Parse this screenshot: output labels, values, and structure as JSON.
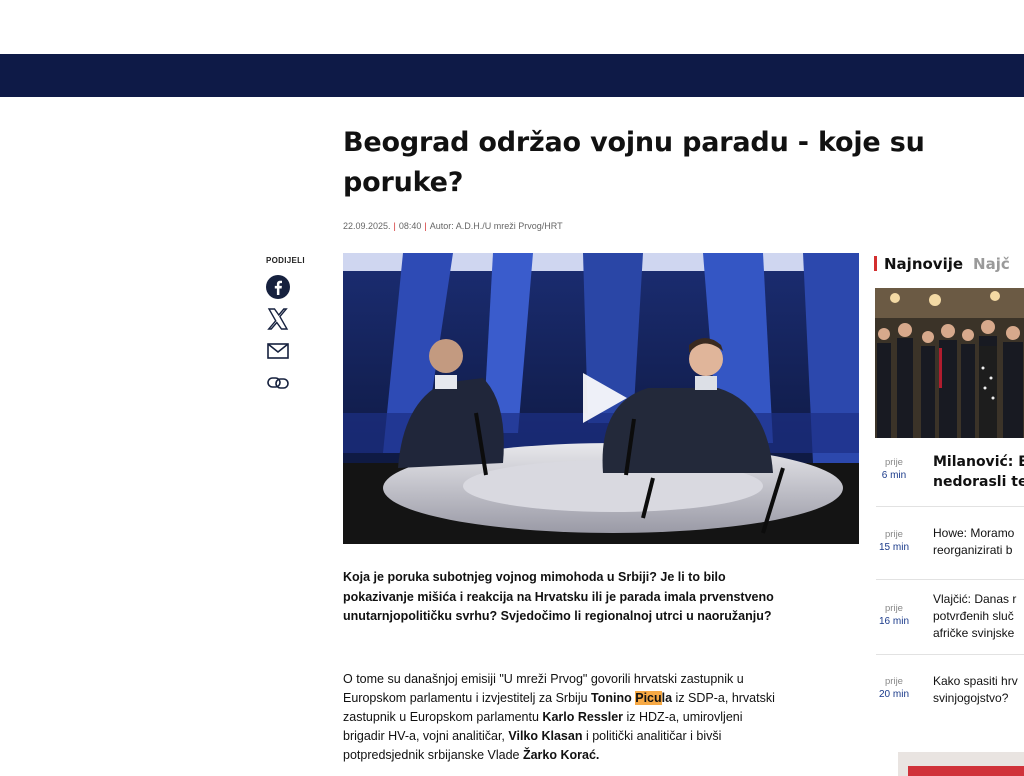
{
  "article": {
    "title": "Beograd održao vojnu paradu - koje su poruke?",
    "date": "22.09.2025.",
    "time": "08:40",
    "author": "Autor: A.D.H./U mreži Prvog/HRT",
    "lead": "Koja je poruka subotnjeg vojnog mimohoda u Srbiji? Je li to bilo pokazivanje mišića i reakcija na Hrvatsku ili je parada imala prvenstveno unutarnjopolitičku svrhu? Svjedočimo li regionalnoj utrci u naoružanju?",
    "body": [
      "O tome su današnjoj emisiji \"U mreži Prvog\" govorili hrvatski zastupnik u Europskom parlamentu i izvjestitelj za Srbiju ",
      "Tonino ",
      "Picu",
      "la",
      " iz SDP-a, hrvatski zastupnik u Europskom parlamentu ",
      "Karlo Ressler",
      " iz HDZ-a, umirovljeni brigadir HV-a, vojni analitičar, ",
      "Vilko Klasan",
      " i politički analitičar i bivši potpredsjednik srbijanske Vlade ",
      "Žarko Korać."
    ]
  },
  "share": {
    "label": "PODIJELI",
    "icons": [
      "facebook-icon",
      "x-icon",
      "email-icon",
      "link-icon"
    ]
  },
  "video": {
    "icon": "play-icon"
  },
  "sidebar": {
    "tabs": [
      "Najnovije",
      "Najč"
    ],
    "items": [
      {
        "prefix": "prije",
        "time": "6 min",
        "title_lines": [
          "Milanović: E",
          "nedorasli te"
        ]
      },
      {
        "prefix": "prije",
        "time": "15 min",
        "title_lines": [
          "Howe: Moramo",
          "reorganizirati b"
        ]
      },
      {
        "prefix": "prije",
        "time": "16 min",
        "title_lines": [
          "Vlajčić: Danas r",
          "potvrđenih sluč",
          "afričke svinjske"
        ]
      },
      {
        "prefix": "prije",
        "time": "20 min",
        "title_lines": [
          "Kako spasiti hrv",
          "svinjogojstvo?"
        ]
      }
    ]
  },
  "colors": {
    "topbar": "#0e1a47",
    "accent": "#d32f2f",
    "highlight": "#f7a944",
    "time_blue": "#1a3a8a"
  }
}
